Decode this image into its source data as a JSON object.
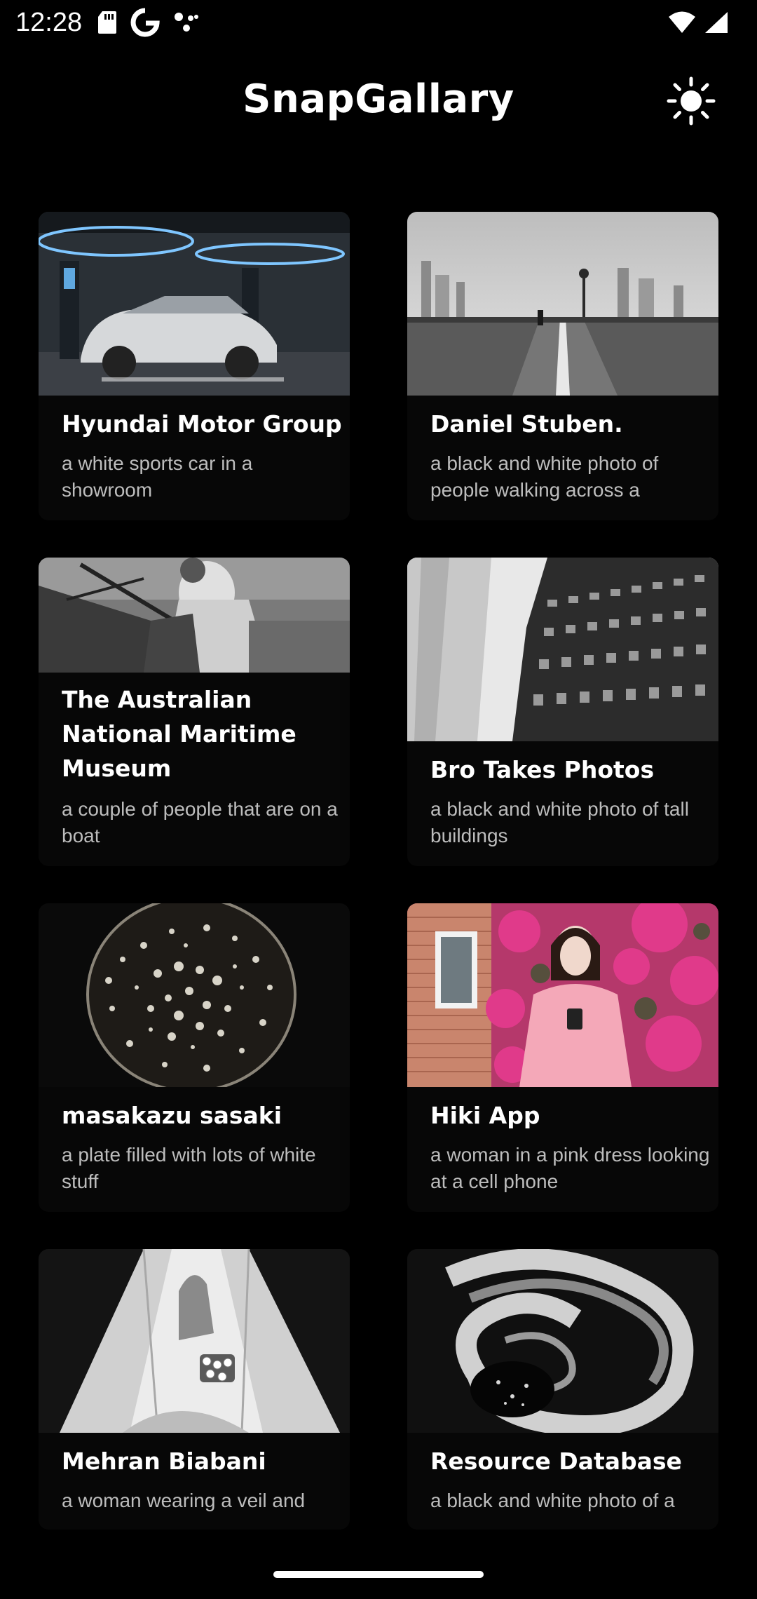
{
  "status_bar": {
    "time": "12:28",
    "icons_left": [
      "sd-card-icon",
      "google-icon",
      "assistant-dots-icon"
    ],
    "icons_right": [
      "wifi-icon",
      "signal-icon"
    ]
  },
  "header": {
    "title": "SnapGallary",
    "theme_toggle_icon": "sun-icon"
  },
  "cards": [
    {
      "title": "Hyundai Motor Group",
      "description": "a white sports car in a showroom"
    },
    {
      "title": "Daniel Stuben.",
      "description": "a black and white photo of people walking across a"
    },
    {
      "title": "The Australian National Maritime Museum",
      "description": "a couple of people that are on a boat"
    },
    {
      "title": "Bro Takes Photos",
      "description": "a black and white photo of tall buildings"
    },
    {
      "title": "masakazu sasaki",
      "description": "a plate filled with lots of white stuff"
    },
    {
      "title": "Hiki App",
      "description": "a woman in a pink dress looking at a cell phone"
    },
    {
      "title": "Mehran Biabani",
      "description": "a woman wearing a veil and"
    },
    {
      "title": "Resource Database",
      "description": "a black and white photo of a"
    }
  ],
  "colors": {
    "background": "#000000",
    "card_background": "#070707",
    "title_text": "#ffffff",
    "description_text": "#bdbdbd"
  }
}
